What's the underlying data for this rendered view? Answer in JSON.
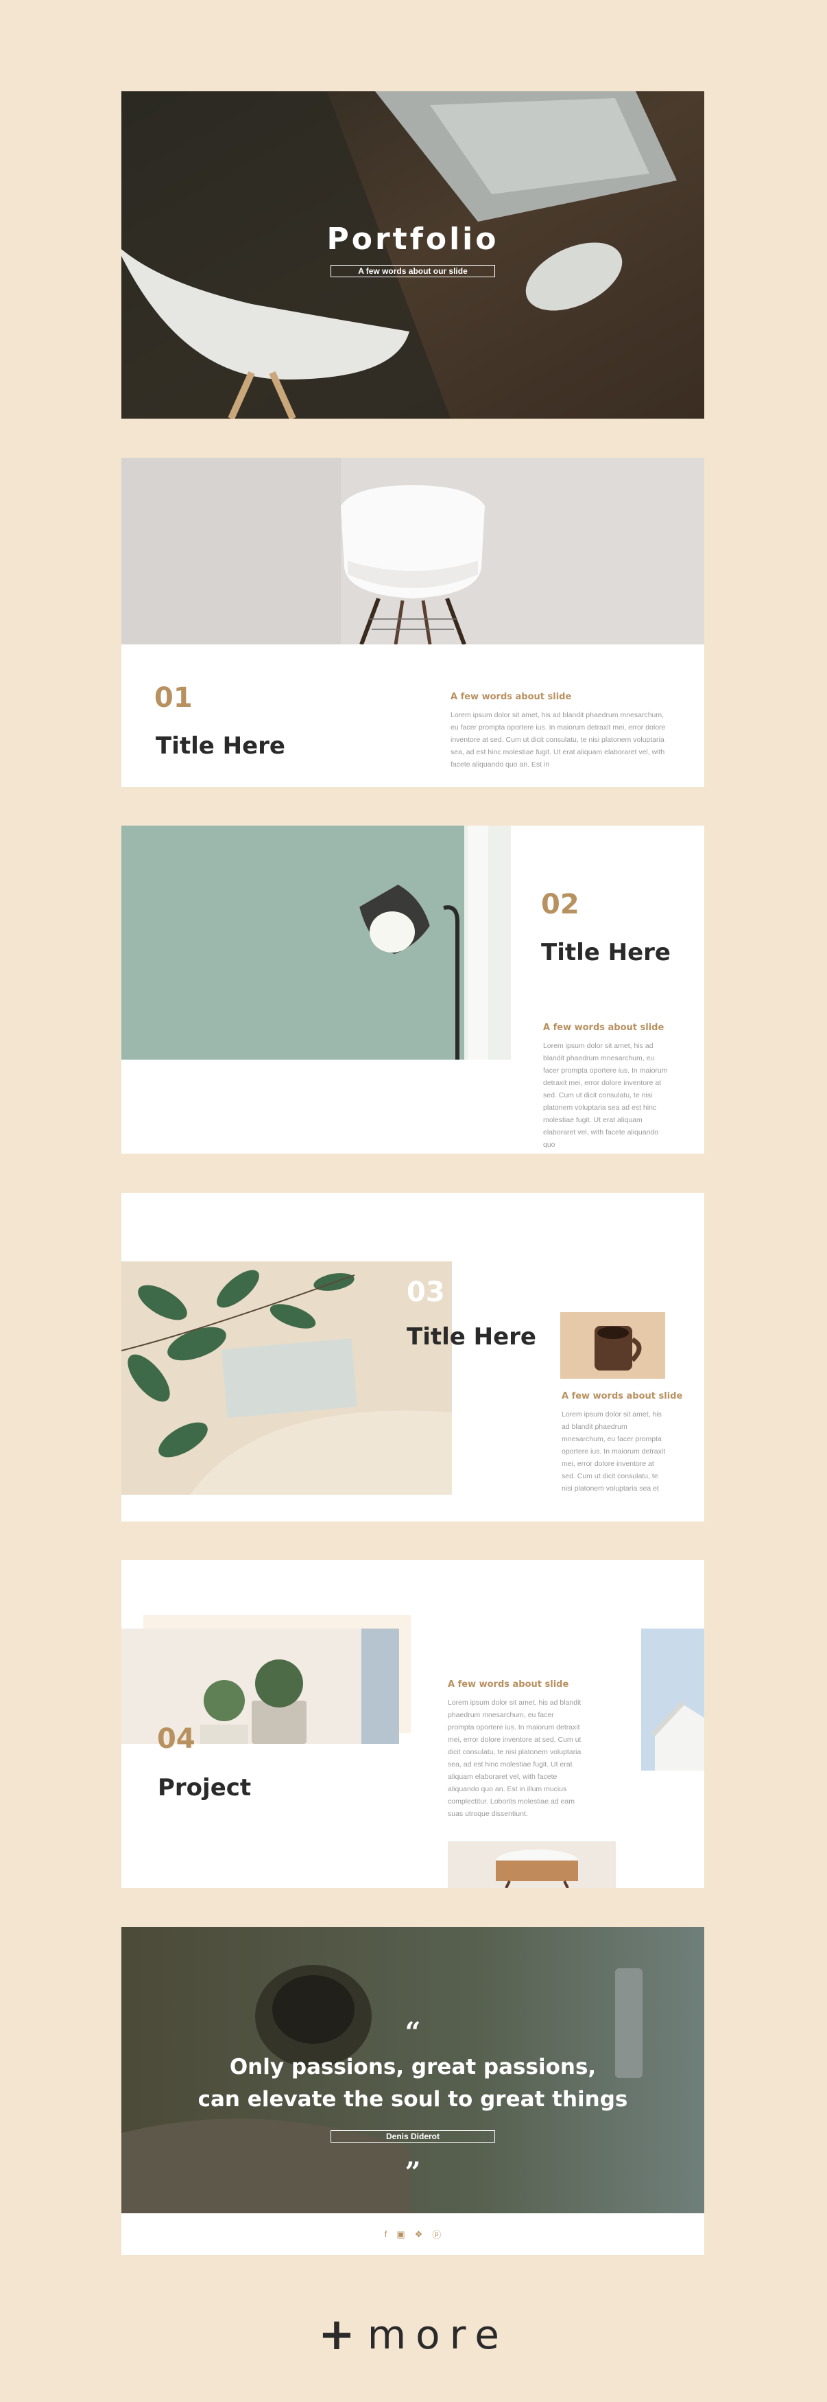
{
  "cover": {
    "title": "Portfolio",
    "subtitle": "A few words about our slide"
  },
  "slide1": {
    "number": "01",
    "title": "Title Here",
    "subtitle": "A few words about slide",
    "body": "Lorem ipsum dolor sit amet, his ad blandit phaedrum mnesarchum, eu facer prompta oportere ius. In maiorum detraxit mei, error dolore inventore at sed. Cum ut dicit consulatu, te nisi platonem voluptaria sea, ad est hinc molestiae fugit. Ut erat aliquam elaboraret vel, with facete aliquando quo an. Est in"
  },
  "slide2": {
    "number": "02",
    "title": "Title Here",
    "subtitle": "A few words about slide",
    "body": "Lorem ipsum dolor sit amet, his ad blandit phaedrum mnesarchum, eu facer prompta oportere ius. In maiorum detraxit mei, error dolore inventore at sed. Cum ut dicit consulatu, te nisi platonem voluptaria sea ad est hinc molestiae fugit. Ut erat aliquam elaboraret vel, with facete aliquando quo"
  },
  "slide3": {
    "number": "03",
    "title": "Title Here",
    "subtitle": "A few words about slide",
    "body": "Lorem ipsum dolor sit amet, his ad blandit phaedrum mnesarchum, eu facer prompta oportere ius. In maiorum detraxit mei, error dolore inventore at sed. Cum ut dicit consulatu, te nisi platonem voluptaria sea et"
  },
  "slide4": {
    "number": "04",
    "title": "Project",
    "subtitle": "A few words about slide",
    "body": "Lorem ipsum dolor sit amet, his ad blandit phaedrum mnesarchum, eu facer prompta oportere ius. In maiorum detraxit mei, error dolore inventore at sed. Cum ut dicit consulatu, te nisi platonem voluptaria sea, ad est hinc molestiae fugit. Ut erat aliquam elaboraret vel, with facete aliquando quo an. Est in illum mucius complectitur. Lobortis molestiae ad eam suas utroque dissentiunt."
  },
  "quote": {
    "open_mark": "“",
    "close_mark": "”",
    "line1": "Only passions, great passions,",
    "line2": "can elevate the soul to great things",
    "author": "Denis Diderot",
    "social": {
      "facebook": "f",
      "instagram": "▣",
      "twitter": "❖",
      "pinterest": "ⓟ"
    }
  },
  "more": {
    "plus": "+",
    "label": "more"
  },
  "colors": {
    "background": "#f3e5cf",
    "accent": "#b89160",
    "text": "#2a2a2a"
  }
}
